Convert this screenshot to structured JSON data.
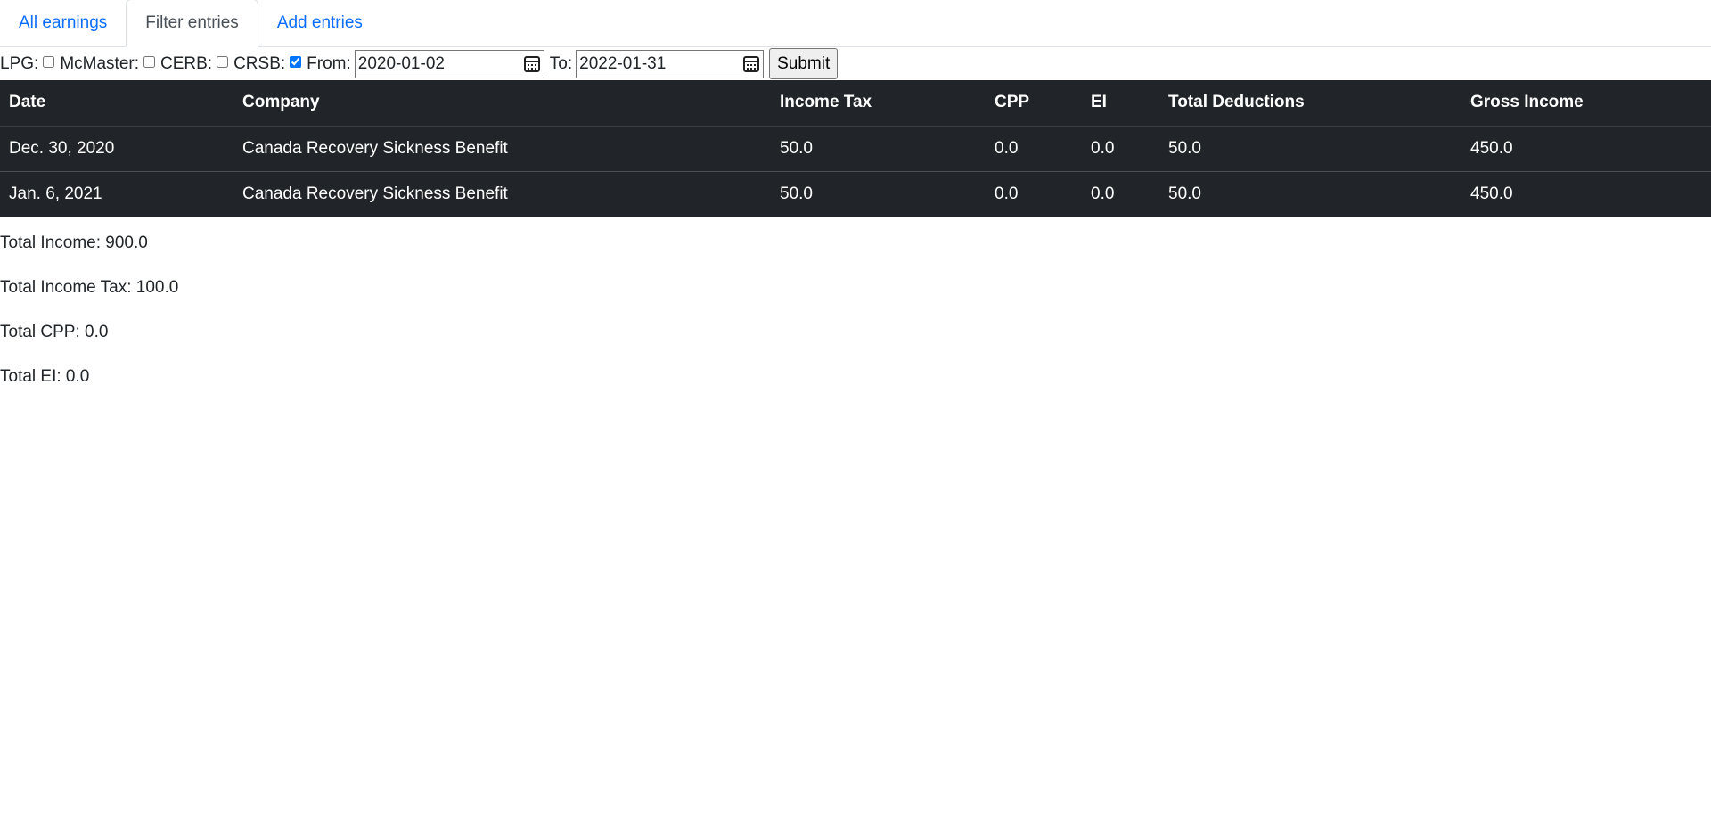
{
  "tabs": [
    {
      "label": "All earnings",
      "active": false
    },
    {
      "label": "Filter entries",
      "active": true
    },
    {
      "label": "Add entries",
      "active": false
    }
  ],
  "filter": {
    "lpg_label": "LPG:",
    "lpg_checked": false,
    "mcmaster_label": "McMaster:",
    "mcmaster_checked": false,
    "cerb_label": "CERB:",
    "cerb_checked": false,
    "crsb_label": "CRSB:",
    "crsb_checked": true,
    "from_label": "From:",
    "from_value": "2020-01-02",
    "to_label": "To:",
    "to_value": "2022-01-31",
    "submit_label": "Submit"
  },
  "table": {
    "headers": [
      "Date",
      "Company",
      "Income Tax",
      "CPP",
      "EI",
      "Total Deductions",
      "Gross Income"
    ],
    "rows": [
      [
        "Dec. 30, 2020",
        "Canada Recovery Sickness Benefit",
        "50.0",
        "0.0",
        "0.0",
        "50.0",
        "450.0"
      ],
      [
        "Jan. 6, 2021",
        "Canada Recovery Sickness Benefit",
        "50.0",
        "0.0",
        "0.0",
        "50.0",
        "450.0"
      ]
    ]
  },
  "totals": {
    "income": "Total Income: 900.0",
    "income_tax": "Total Income Tax: 100.0",
    "cpp": "Total CPP: 0.0",
    "ei": "Total EI: 0.0"
  },
  "colors": {
    "link": "#0d6efd",
    "table_bg": "#212529",
    "table_text": "#ffffff"
  },
  "icons": {
    "calendar": "calendar-icon"
  }
}
